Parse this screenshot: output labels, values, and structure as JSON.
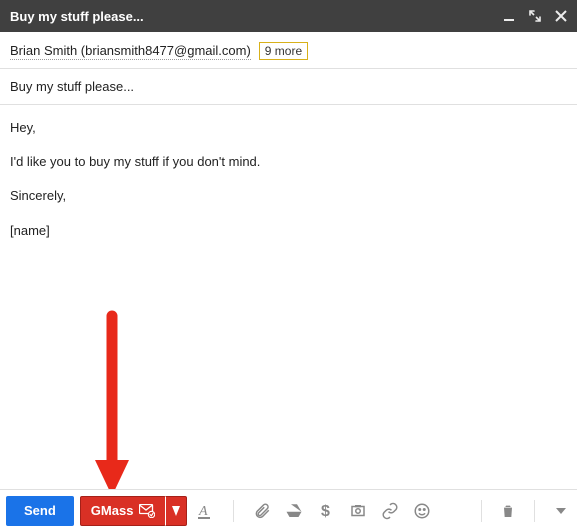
{
  "window": {
    "title": "Buy my stuff please..."
  },
  "recipients": {
    "primary": "Brian Smith (briansmith8477@gmail.com)",
    "more_label": "9 more"
  },
  "subject": "Buy my stuff please...",
  "body": {
    "greeting": "Hey,",
    "line1": "I'd like you to buy my stuff if you don't mind.",
    "closing": "Sincerely,",
    "signature": "[name]"
  },
  "toolbar": {
    "send_label": "Send",
    "gmass_label": "GMass"
  }
}
